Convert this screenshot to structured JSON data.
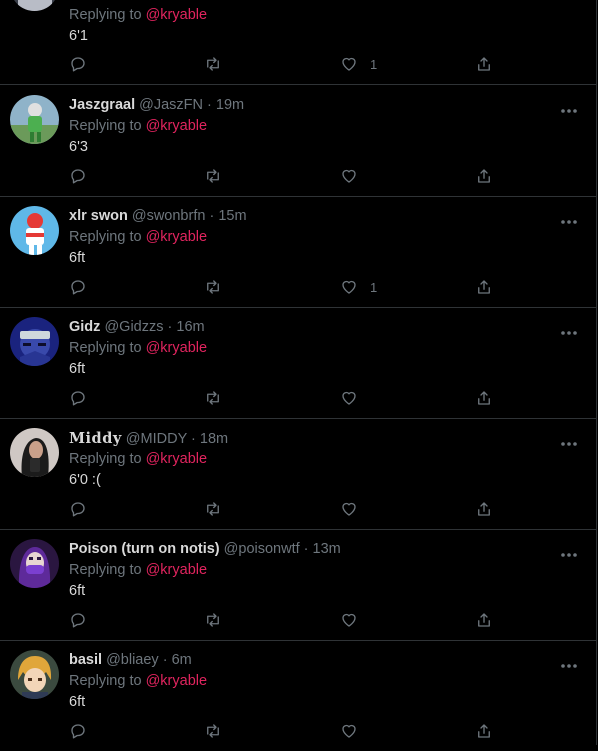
{
  "colors": {
    "background": "#000000",
    "text": "#d9d9d9",
    "muted": "#6e767d",
    "mention": "#e0245e",
    "divider": "#2f3336"
  },
  "replies": [
    {
      "name": "",
      "handle": "",
      "time": "",
      "replying_label": "Replying to",
      "mention": "@kryable",
      "text": "6'1",
      "like_count": "1",
      "avatar_icon": "avatar-white-figure-icon"
    },
    {
      "name": "Jaszgraal",
      "handle": "@JaszFN",
      "time": "19m",
      "replying_label": "Replying to",
      "mention": "@kryable",
      "text": "6'3",
      "like_count": "",
      "avatar_icon": "avatar-green-character-icon"
    },
    {
      "name": "xlr swon",
      "handle": "@swonbrfn",
      "time": "15m",
      "replying_label": "Replying to",
      "mention": "@kryable",
      "text": "6ft",
      "like_count": "1",
      "avatar_icon": "avatar-red-white-character-icon"
    },
    {
      "name": "Gidz",
      "handle": "@Gidzzs",
      "time": "16m",
      "replying_label": "Replying to",
      "mention": "@kryable",
      "text": "6ft",
      "like_count": "",
      "avatar_icon": "avatar-anime-ninja-icon"
    },
    {
      "name": "𝐌𝐢𝐝𝐝𝐲",
      "handle": "@MIDDY",
      "time": "18m",
      "replying_label": "Replying to",
      "mention": "@kryable",
      "text": "6'0 :(",
      "like_count": "",
      "avatar_icon": "avatar-mirror-selfie-icon"
    },
    {
      "name": "Poison (turn on notis)",
      "handle": "@poisonwtf",
      "time": "13m",
      "replying_label": "Replying to",
      "mention": "@kryable",
      "text": "6ft",
      "like_count": "",
      "avatar_icon": "avatar-purple-masked-icon"
    },
    {
      "name": "basil",
      "handle": "@bliaey",
      "time": "6m",
      "replying_label": "Replying to",
      "mention": "@kryable",
      "text": "6ft",
      "like_count": "",
      "avatar_icon": "avatar-anime-boy-icon"
    }
  ],
  "icons": {
    "reply": "reply-icon",
    "retweet": "retweet-icon",
    "like": "like-icon",
    "share": "share-icon",
    "more": "more-icon"
  }
}
